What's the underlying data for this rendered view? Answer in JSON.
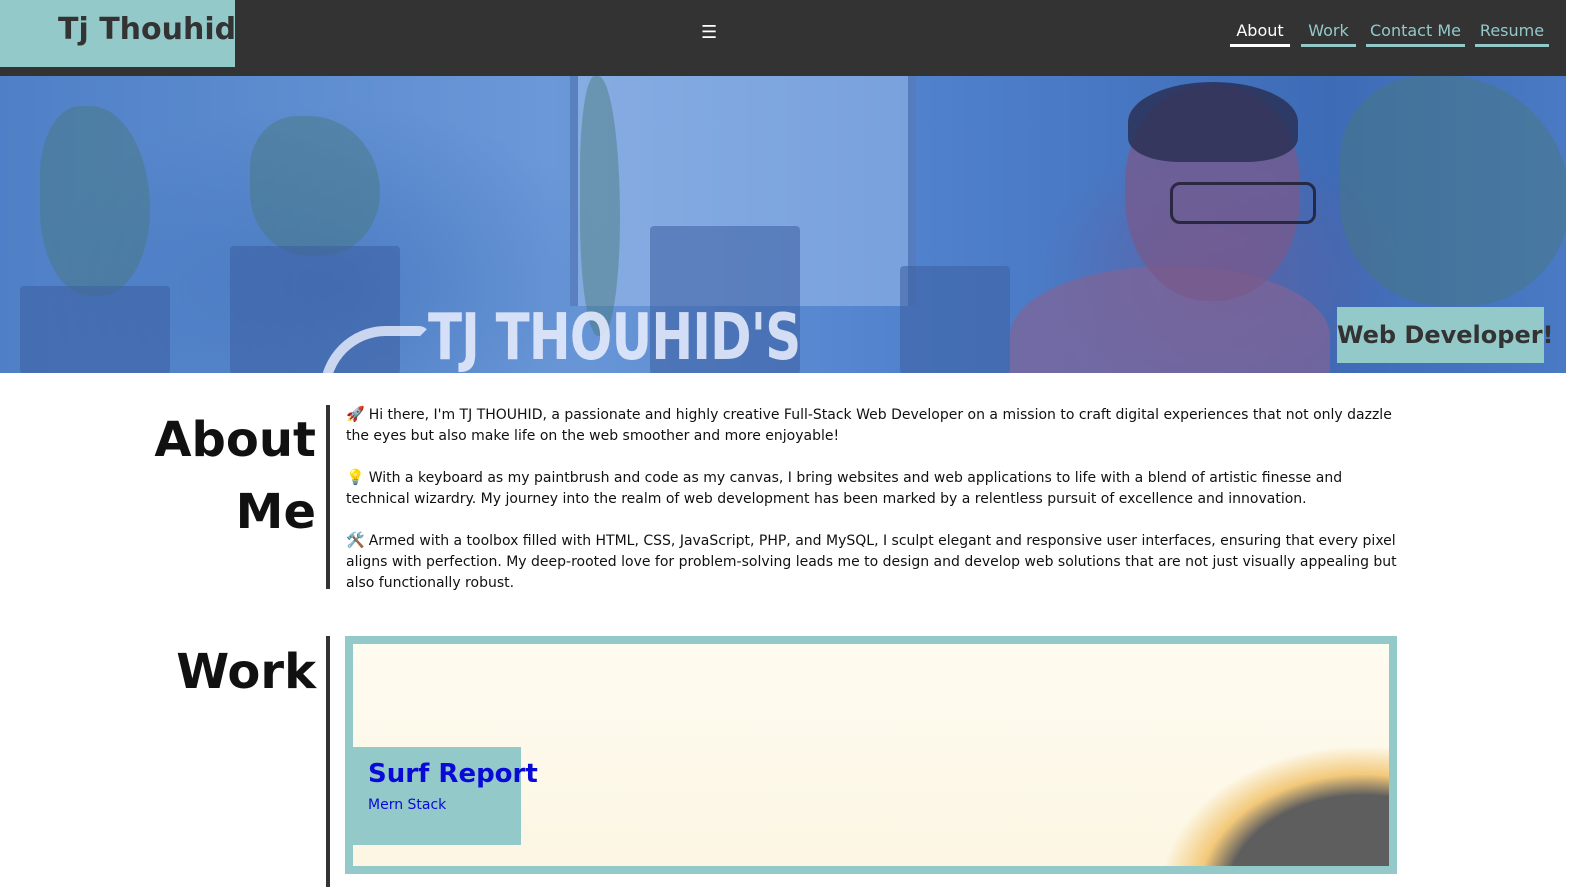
{
  "brand": {
    "name": "Tj Thouhid"
  },
  "nav": {
    "menu_icon": "☰",
    "links": [
      {
        "label": "About",
        "active": true
      },
      {
        "label": "Work",
        "active": false
      },
      {
        "label": "Contact Me",
        "active": false
      },
      {
        "label": "Resume",
        "active": false
      }
    ]
  },
  "hero": {
    "tagline": "TJ THOUHID'S",
    "role_badge": "Web Developer!"
  },
  "about": {
    "title_line1": "About",
    "title_line2": "Me",
    "paragraphs": [
      {
        "icon": "rocket-icon",
        "emoji": "🚀",
        "text": "Hi there, I'm TJ THOUHID, a passionate and highly creative Full-Stack Web Developer on a mission to craft digital experiences that not only dazzle the eyes but also make life on the web smoother and more enjoyable!"
      },
      {
        "icon": "lightbulb-icon",
        "emoji": "💡",
        "text": "With a keyboard as my paintbrush and code as my canvas, I bring websites and web applications to life with a blend of artistic finesse and technical wizardry. My journey into the realm of web development has been marked by a relentless pursuit of excellence and innovation."
      },
      {
        "icon": "tools-icon",
        "emoji": "🛠️",
        "text": "Armed with a toolbox filled with HTML, CSS, JavaScript, PHP, and MySQL, I sculpt elegant and responsive user interfaces, ensuring that every pixel aligns with perfection. My deep-rooted love for problem-solving leads me to design and develop web solutions that are not just visually appealing but also functionally robust."
      }
    ]
  },
  "work": {
    "title": "Work",
    "projects": [
      {
        "title": "Surf Report",
        "subtitle": "Mern Stack"
      }
    ]
  },
  "colors": {
    "accent": "#94c9c9",
    "nav_background": "#333333",
    "hero_tint": "#4f7fc6",
    "project_link": "#0a0ad8"
  }
}
